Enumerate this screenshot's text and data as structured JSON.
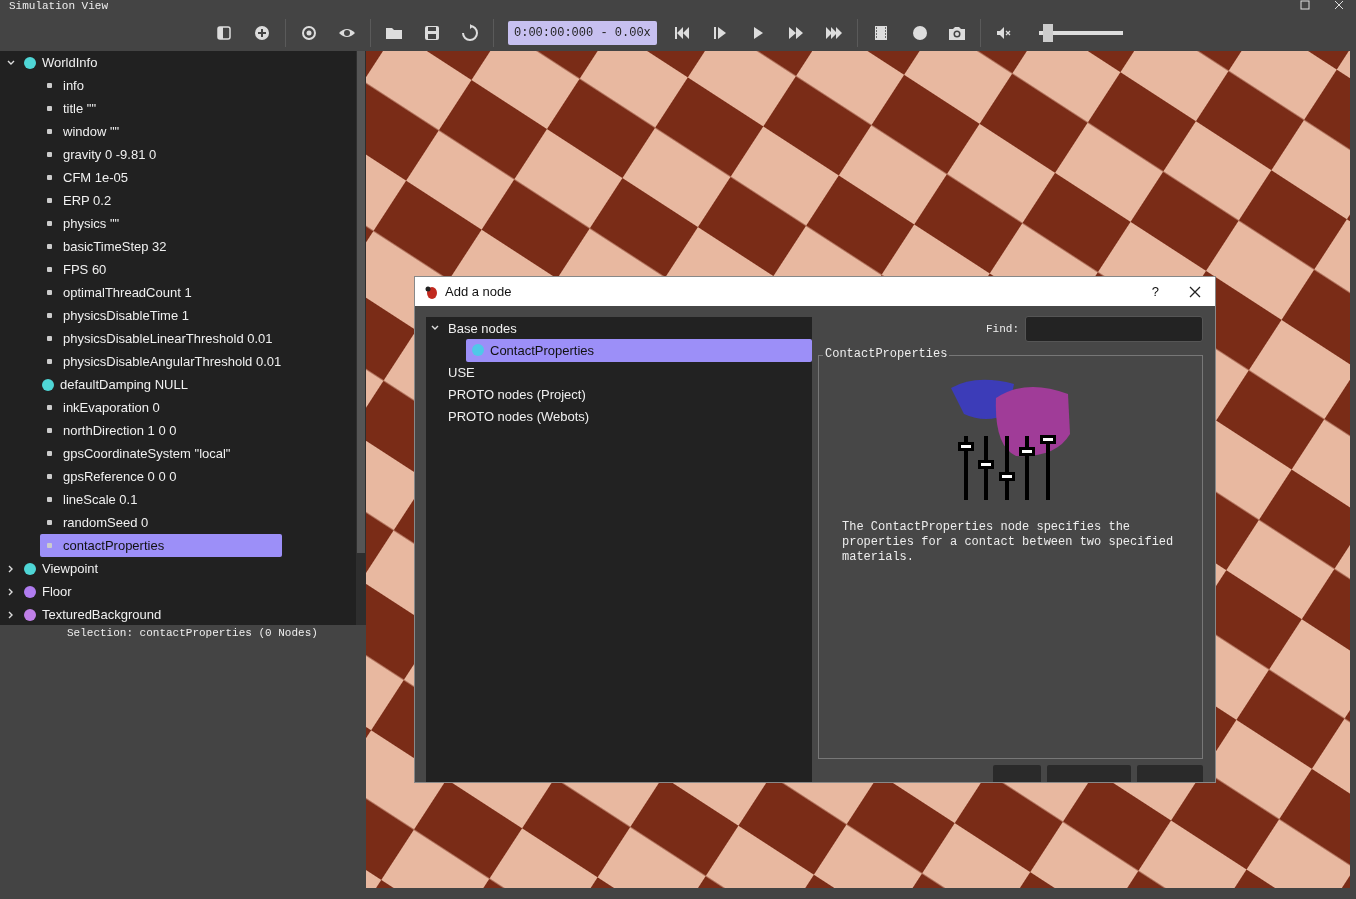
{
  "window": {
    "title": "Simulation View"
  },
  "toolbar": {
    "clock": "0:00:00:000 - 0.00x",
    "volume": {
      "level": 0.06
    }
  },
  "scene_tree": [
    {
      "label": "WorldInfo",
      "kind": "node",
      "color": "#4fd6d6",
      "expanded": true,
      "selected": false,
      "children": [
        {
          "label": "info",
          "kind": "field",
          "selected": false
        },
        {
          "label": "title \"\"",
          "kind": "field",
          "selected": false
        },
        {
          "label": "window \"\"",
          "kind": "field",
          "selected": false
        },
        {
          "label": "gravity 0 -9.81 0",
          "kind": "field",
          "selected": false
        },
        {
          "label": "CFM 1e-05",
          "kind": "field",
          "selected": false
        },
        {
          "label": "ERP 0.2",
          "kind": "field",
          "selected": false
        },
        {
          "label": "physics \"\"",
          "kind": "field",
          "selected": false
        },
        {
          "label": "basicTimeStep 32",
          "kind": "field",
          "selected": false
        },
        {
          "label": "FPS 60",
          "kind": "field",
          "selected": false
        },
        {
          "label": "optimalThreadCount 1",
          "kind": "field",
          "selected": false
        },
        {
          "label": "physicsDisableTime 1",
          "kind": "field",
          "selected": false
        },
        {
          "label": "physicsDisableLinearThreshold 0.01",
          "kind": "field",
          "selected": false
        },
        {
          "label": "physicsDisableAngularThreshold 0.01",
          "kind": "field",
          "selected": false
        },
        {
          "label": "defaultDamping NULL",
          "kind": "node",
          "color": "#4fd6d6",
          "selected": false
        },
        {
          "label": "inkEvaporation 0",
          "kind": "field",
          "selected": false
        },
        {
          "label": "northDirection 1 0 0",
          "kind": "field",
          "selected": false
        },
        {
          "label": "gpsCoordinateSystem \"local\"",
          "kind": "field",
          "selected": false
        },
        {
          "label": "gpsReference 0 0 0",
          "kind": "field",
          "selected": false
        },
        {
          "label": "lineScale 0.1",
          "kind": "field",
          "selected": false
        },
        {
          "label": "randomSeed 0",
          "kind": "field",
          "selected": false
        },
        {
          "label": "contactProperties",
          "kind": "field",
          "selected": true
        }
      ]
    },
    {
      "label": "Viewpoint",
      "kind": "node",
      "color": "#4fd6d6",
      "expanded": false,
      "selected": false
    },
    {
      "label": "Floor",
      "kind": "node",
      "color": "#b07cf0",
      "expanded": false,
      "selected": false
    },
    {
      "label": "TexturedBackground",
      "kind": "node",
      "color": "#c080e8",
      "expanded": false,
      "selected": false
    }
  ],
  "status_bar": "Selection: contactProperties (0 Nodes)",
  "dialog": {
    "title": "Add a node",
    "help": "?",
    "tree": [
      {
        "label": "Base nodes",
        "expanded": true,
        "selected": false,
        "children": [
          {
            "label": "ContactProperties",
            "color": "#4fc8e8",
            "selected": true
          }
        ]
      },
      {
        "label": "USE",
        "selected": false
      },
      {
        "label": "PROTO nodes (Project)",
        "selected": false
      },
      {
        "label": "PROTO nodes (Webots)",
        "selected": false
      }
    ],
    "find": {
      "label": "Find:"
    },
    "preview": {
      "title": "ContactProperties",
      "description": "The ContactProperties node specifies the properties for a contact between two specified materials."
    },
    "buttons": [
      {
        "kind": "button"
      },
      {
        "kind": "button"
      },
      {
        "kind": "button"
      }
    ]
  }
}
